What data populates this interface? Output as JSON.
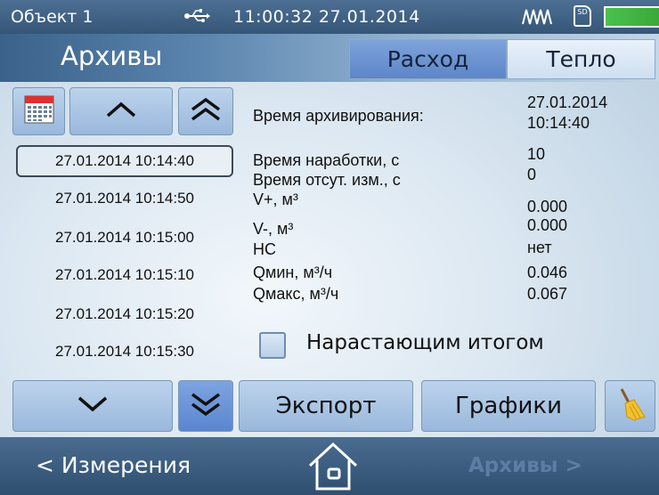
{
  "status": {
    "object": "Объект 1",
    "time": "11:00:32",
    "date": "27.01.2014",
    "sd_label": "SD",
    "icons": [
      "usb-icon",
      "signal-wave-icon",
      "sd-card-icon",
      "battery-icon"
    ]
  },
  "header": {
    "title": "Архивы",
    "tabs": [
      {
        "label": "Расход",
        "active": true
      },
      {
        "label": "Тепло",
        "active": false
      }
    ]
  },
  "archive_list": {
    "records": [
      "27.01.2014  10:14:40",
      "27.01.2014  10:14:50",
      "27.01.2014  10:15:00",
      "27.01.2014  10:15:10",
      "27.01.2014  10:15:20",
      "27.01.2014  10:15:30"
    ],
    "selected_index": 0
  },
  "details": {
    "archive_time_label": "Время архивирования:",
    "archive_date": "27.01.2014",
    "archive_time": "10:14:40",
    "rows": [
      {
        "label": "Время наработки, с",
        "value": "10"
      },
      {
        "label": "Время отсут. изм., с",
        "value": "0"
      },
      {
        "label": "V+, м³",
        "value": "0.000"
      },
      {
        "label": "V-, м³",
        "value": "0.000"
      },
      {
        "label": "НС",
        "value": "нет"
      },
      {
        "label": "Qмин, м³/ч",
        "value": "0.046"
      },
      {
        "label": "Qмакс, м³/ч",
        "value": "0.067"
      }
    ]
  },
  "cumulative": {
    "label": "Нарастающим итогом",
    "checked": false
  },
  "buttons": {
    "export": "Экспорт",
    "graphs": "Графики"
  },
  "nav": {
    "back": "< Измерения",
    "next": "Архивы >"
  },
  "colors": {
    "status_bar": "#3c5e82",
    "active_tab": "#6f95d5",
    "inactive_tab": "#dbe7f4",
    "battery": "#3fb43f"
  }
}
